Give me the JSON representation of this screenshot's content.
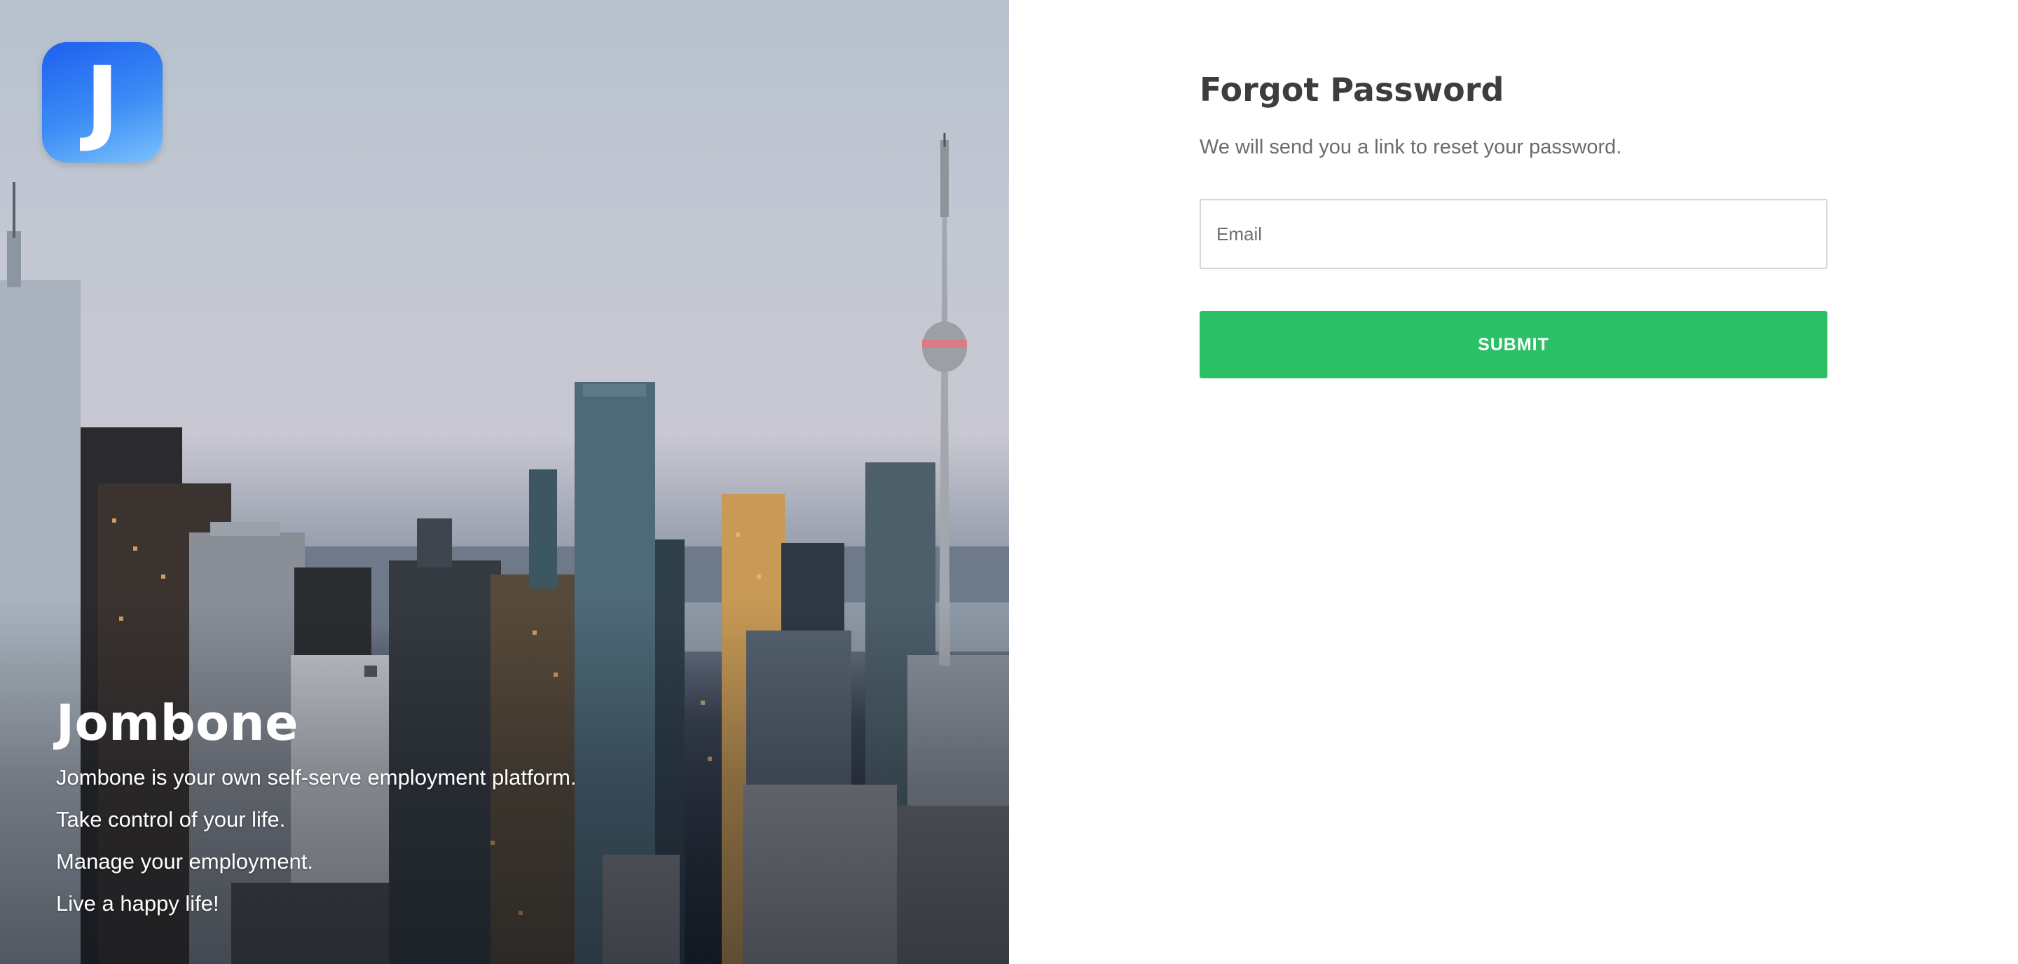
{
  "hero": {
    "logo_letter": "J",
    "brand_name": "Jombone",
    "taglines": [
      "Jombone is your own self-serve employment platform.",
      "Take control of your life.",
      "Manage your employment.",
      "Live a happy life!"
    ],
    "background": "city-skyline-photo",
    "logo_gradient": [
      "#1d5ff0",
      "#7cc2fb"
    ]
  },
  "form": {
    "title": "Forgot Password",
    "subtitle": "We will send you a link to reset your password.",
    "email": {
      "value": "",
      "placeholder": "Email"
    },
    "submit_label": "SUBMIT"
  },
  "colors": {
    "accent": "#2bbf66",
    "title_text": "#3d3d3d",
    "muted_text": "#6b6b6b"
  }
}
